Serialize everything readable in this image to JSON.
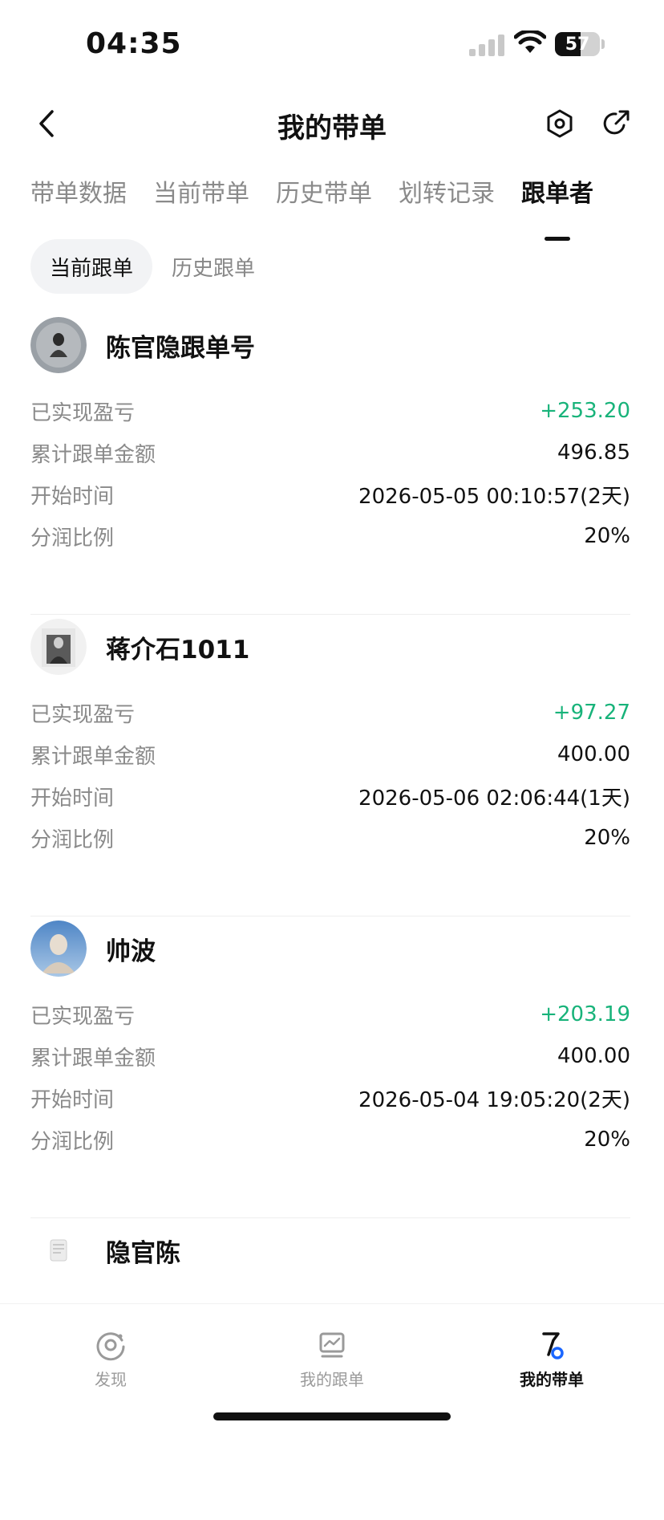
{
  "status_bar": {
    "time": "04:35",
    "battery": "57"
  },
  "header": {
    "title": "我的带单",
    "back_icon": "chevron-left-icon",
    "settings_icon": "hexagon-settings-icon",
    "share_icon": "share-icon"
  },
  "tabs": [
    {
      "label": "带单数据",
      "active": false
    },
    {
      "label": "当前带单",
      "active": false
    },
    {
      "label": "历史带单",
      "active": false
    },
    {
      "label": "划转记录",
      "active": false
    },
    {
      "label": "跟单者",
      "active": true
    }
  ],
  "subtabs": [
    {
      "label": "当前跟单",
      "active": true
    },
    {
      "label": "历史跟单",
      "active": false
    }
  ],
  "labels": {
    "pnl": "已实现盈亏",
    "amount": "累计跟单金额",
    "start": "开始时间",
    "share": "分润比例"
  },
  "followers": [
    {
      "name": "陈官隐跟单号",
      "pnl": "+253.20",
      "amount": "496.85",
      "start": "2026-05-05 00:10:57(2天)",
      "share": "20%"
    },
    {
      "name": "蒋介石1011",
      "pnl": "+97.27",
      "amount": "400.00",
      "start": "2026-05-06 02:06:44(1天)",
      "share": "20%"
    },
    {
      "name": "帅波",
      "pnl": "+203.19",
      "amount": "400.00",
      "start": "2026-05-04 19:05:20(2天)",
      "share": "20%"
    },
    {
      "name": "隐官陈"
    }
  ],
  "bottom_nav": [
    {
      "label": "发现",
      "icon": "discover-icon",
      "active": false
    },
    {
      "label": "我的跟单",
      "icon": "chart-icon",
      "active": false
    },
    {
      "label": "我的带单",
      "icon": "lead-trade-icon",
      "active": true
    }
  ],
  "colors": {
    "positive": "#18b37a",
    "text": "#111111",
    "muted": "#8a8a8a"
  }
}
